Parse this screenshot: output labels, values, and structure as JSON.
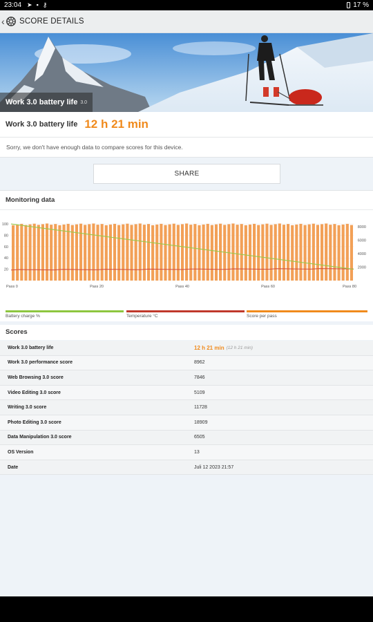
{
  "status_bar": {
    "time": "23:04",
    "battery": "17 %"
  },
  "app_bar": {
    "title": "SCORE DETAILS"
  },
  "hero": {
    "label": "Work 3.0 battery life",
    "version": "3.0"
  },
  "result": {
    "name": "Work 3.0 battery life",
    "value": "12 h 21 min"
  },
  "compare_note": "Sorry, we don't have enough data to compare scores for this device.",
  "share_label": "SHARE",
  "monitoring": {
    "title": "Monitoring data",
    "legend": [
      "Battery charge %",
      "Temperature °C",
      "Score per pass"
    ]
  },
  "chart_data": {
    "type": "bar",
    "x_label_ticks": [
      "Pass 0",
      "Pass 20",
      "Pass 40",
      "Pass 60",
      "Pass 80"
    ],
    "x_tick_values": [
      0,
      20,
      40,
      60,
      80
    ],
    "x_range": [
      0,
      80
    ],
    "left_axis": {
      "ticks": [
        20,
        40,
        60,
        80,
        100
      ],
      "range": [
        0,
        105
      ]
    },
    "right_axis": {
      "ticks": [
        2000,
        4000,
        6000,
        8000
      ],
      "range": [
        0,
        8800
      ]
    },
    "series": [
      {
        "name": "Score per pass",
        "axis": "right",
        "color": "#f2a057",
        "count": 81,
        "value_range": [
          8200,
          8450
        ]
      },
      {
        "name": "Battery charge %",
        "axis": "left",
        "color": "#99c94a",
        "start": [
          0,
          100
        ],
        "end": [
          80,
          20
        ]
      },
      {
        "name": "Temperature °C",
        "axis": "left",
        "color": "#d34a3a",
        "start": [
          0,
          19
        ],
        "end": [
          80,
          21
        ]
      }
    ]
  },
  "scores": {
    "title": "Scores",
    "rows": [
      {
        "label": "Work 3.0 battery life",
        "value": "12 h 21 min",
        "sub": "(12 h 21 min)"
      },
      {
        "label": "Work 3.0 performance score",
        "value": "8962"
      },
      {
        "label": "Web Browsing 3.0 score",
        "value": "7846"
      },
      {
        "label": "Video Editing 3.0 score",
        "value": "5109"
      },
      {
        "label": "Writing 3.0 score",
        "value": "11728"
      },
      {
        "label": "Photo Editing 3.0 score",
        "value": "18909"
      },
      {
        "label": "Data Manipulation 3.0 score",
        "value": "6505"
      },
      {
        "label": "OS Version",
        "value": "13"
      },
      {
        "label": "Date",
        "value": "Juli 12 2023 21:57"
      }
    ]
  },
  "colors": {
    "accent": "#f08a1c",
    "battery": "#8dc63f",
    "temperature": "#c0392b",
    "score": "#f08a1c"
  }
}
